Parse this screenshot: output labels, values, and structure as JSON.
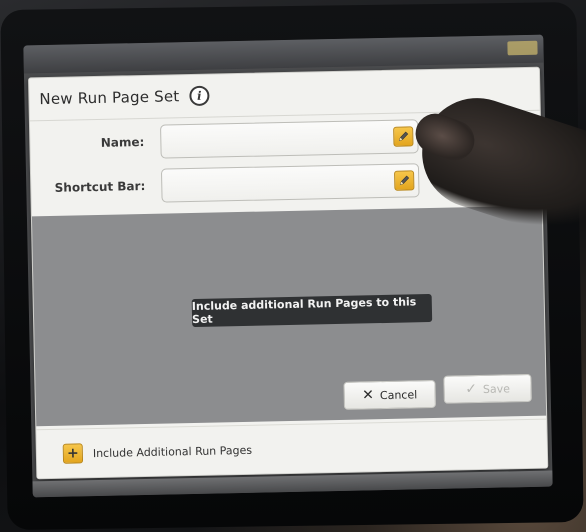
{
  "dialog": {
    "title": "New Run Page Set",
    "info_icon_glyph": "i"
  },
  "form": {
    "name_label": "Name:",
    "name_value": "",
    "shortcut_label": "Shortcut Bar:",
    "shortcut_value": ""
  },
  "tooltip": {
    "text": "Include additional Run Pages to this Set"
  },
  "buttons": {
    "cancel_label": "Cancel",
    "save_label": "Save"
  },
  "footer": {
    "add_glyph": "+",
    "include_label": "Include Additional Run Pages"
  },
  "colors": {
    "accent": "#f0b833",
    "dialog_bg": "#f2f2ef",
    "tooltip_bg": "#2f3133"
  }
}
